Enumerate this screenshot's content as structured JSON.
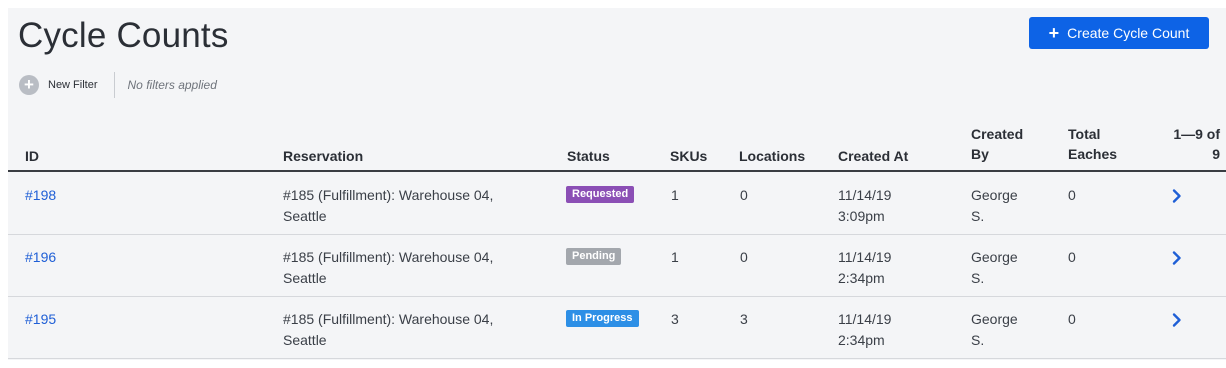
{
  "page": {
    "title": "Cycle Counts",
    "create_button": "Create Cycle Count"
  },
  "filters": {
    "new_filter_label": "New Filter",
    "status_text": "No filters applied"
  },
  "table": {
    "columns": {
      "id": "ID",
      "reservation": "Reservation",
      "status": "Status",
      "skus": "SKUs",
      "locations": "Locations",
      "created_at": "Created At",
      "created_by": "Created By",
      "total_eaches": "Total Eaches",
      "pagination": "1—9 of 9"
    },
    "rows": [
      {
        "id": "#198",
        "reservation": "#185 (Fulfillment): Warehouse 04, Seattle",
        "status": "Requested",
        "status_color": "#8b4fb5",
        "skus": "1",
        "locations": "0",
        "created_at": "11/14/19 3:09pm",
        "created_by": "George S.",
        "total_eaches": "0"
      },
      {
        "id": "#196",
        "reservation": "#185 (Fulfillment): Warehouse 04, Seattle",
        "status": "Pending",
        "status_color": "#a3a7ad",
        "skus": "1",
        "locations": "0",
        "created_at": "11/14/19 2:34pm",
        "created_by": "George S.",
        "total_eaches": "0"
      },
      {
        "id": "#195",
        "reservation": "#185 (Fulfillment): Warehouse 04, Seattle",
        "status": "In Progress",
        "status_color": "#2d8fe6",
        "skus": "3",
        "locations": "3",
        "created_at": "11/14/19 2:34pm",
        "created_by": "George S.",
        "total_eaches": "0"
      }
    ]
  },
  "colors": {
    "accent": "#0d63e6",
    "link": "#1f5fd6",
    "chevron": "#1f5fd6"
  }
}
